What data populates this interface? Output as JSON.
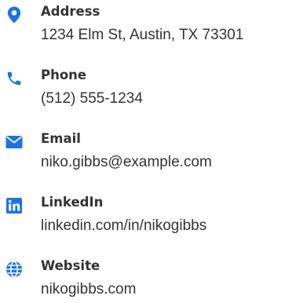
{
  "accent_color": "#1a73e8",
  "contacts": [
    {
      "icon": "map-pin-icon",
      "label": "Address",
      "value": "1234 Elm St, Austin, TX 73301"
    },
    {
      "icon": "phone-icon",
      "label": "Phone",
      "value": "(512) 555-1234"
    },
    {
      "icon": "envelope-icon",
      "label": "Email",
      "value": "niko.gibbs@example.com"
    },
    {
      "icon": "linkedin-icon",
      "label": "LinkedIn",
      "value": "linkedin.com/in/nikogibbs"
    },
    {
      "icon": "globe-icon",
      "label": "Website",
      "value": "nikogibbs.com"
    }
  ]
}
